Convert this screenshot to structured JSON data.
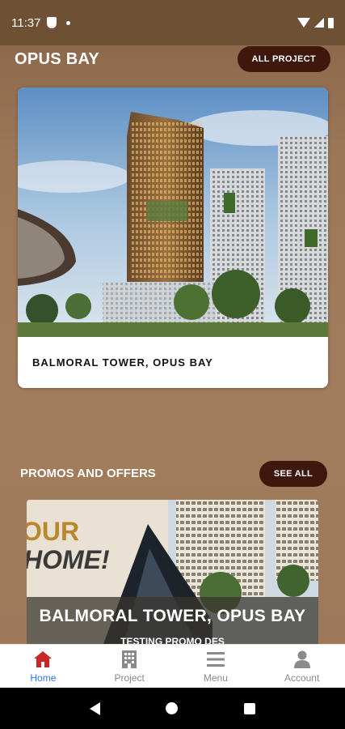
{
  "status_bar": {
    "time": "11:37"
  },
  "project_section": {
    "title": "OPUS BAY",
    "all_button": "ALL PROJECT",
    "card_caption": "BALMORAL TOWER, OPUS BAY"
  },
  "promo_section": {
    "title": "PROMOS AND OFFERS",
    "see_all_button": "SEE ALL",
    "banner_text_1": "OUR",
    "banner_text_2": "HOME!",
    "banner_caption": "BALMORAL TOWER, OPUS BAY",
    "banner_sub": "TESTING PROMO DES"
  },
  "bottom_nav": {
    "items": [
      {
        "label": "Home",
        "icon": "home-icon",
        "active": true
      },
      {
        "label": "Project",
        "icon": "building-icon",
        "active": false
      },
      {
        "label": "Menu",
        "icon": "menu-icon",
        "active": false
      },
      {
        "label": "Account",
        "icon": "account-icon",
        "active": false
      }
    ]
  },
  "colors": {
    "accent": "#3e170d",
    "active_nav": "#2f74ff",
    "background": "#9c7858"
  }
}
